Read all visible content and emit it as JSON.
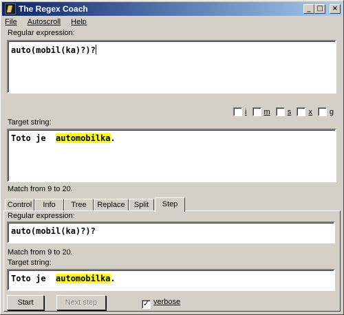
{
  "window": {
    "title": "The Regex Coach"
  },
  "menu": [
    "File",
    "Autoscroll",
    "Help"
  ],
  "main": {
    "regex_label": "Regular expression:",
    "regex_value": "auto(mobil(ka)?)?",
    "flags": [
      "i",
      "m",
      "s",
      "x",
      "g"
    ],
    "target_label": "Target string:",
    "target_before": "Toto je  ",
    "target_match": "automobilka",
    "target_after": ".",
    "match_info": "Match from 9 to 20."
  },
  "tabs": [
    "Control",
    "Info",
    "Tree",
    "Replace",
    "Split",
    "Step"
  ],
  "active_tab": "Step",
  "step": {
    "regex_label": "Regular expression:",
    "regex_value": "auto(mobil(ka)?)?",
    "match_info": "Match from 9 to 20.",
    "target_label": "Target string:",
    "target_before": "Toto je  ",
    "target_match": "automobilka",
    "target_after": ".",
    "start_button": "Start",
    "next_button": "Next step",
    "verbose_label": "verbose",
    "verbose_checked": true
  },
  "colors": {
    "match_highlight": "#ffff00",
    "titlebar_start": "#0a246a",
    "titlebar_end": "#a6caf0"
  }
}
